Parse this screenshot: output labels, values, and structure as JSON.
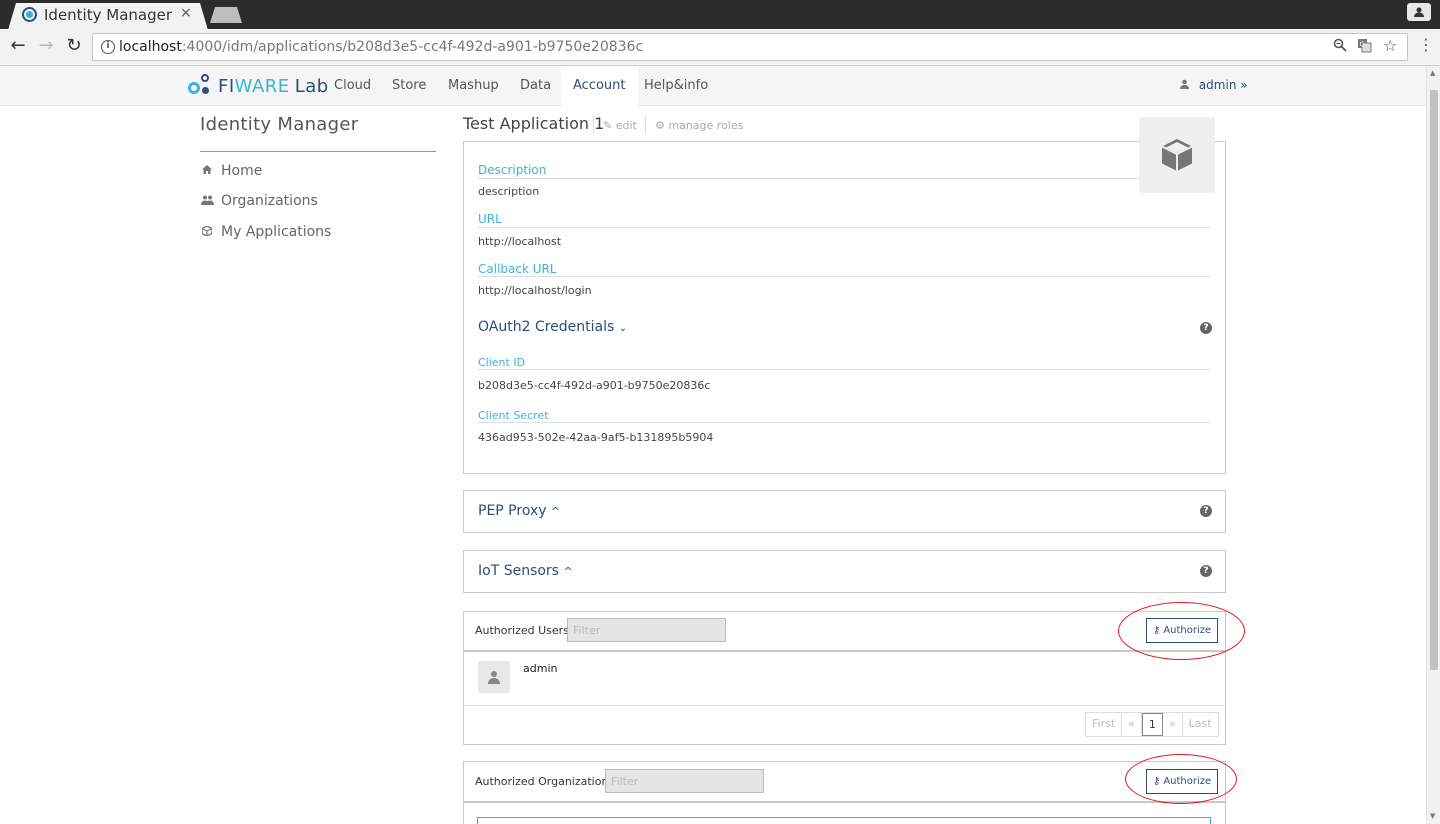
{
  "browser": {
    "tab_title": "Identity Manager",
    "tab_close": "×",
    "url_host": "localhost",
    "url_path": ":4000/idm/applications/b208d3e5-cc4f-492d-a901-b9750e20836c",
    "profile_icon": "person-icon"
  },
  "nav": {
    "logo_fi": "FI",
    "logo_ware": "WARE",
    "logo_lab": "Lab",
    "items": [
      "Cloud",
      "Store",
      "Mashup",
      "Data",
      "Account",
      "Help&info"
    ],
    "active": "Account",
    "user": "admin"
  },
  "sidebar": {
    "title": "Identity Manager",
    "items": [
      {
        "label": "Home",
        "icon": "home-icon"
      },
      {
        "label": "Organizations",
        "icon": "users-icon"
      },
      {
        "label": "My Applications",
        "icon": "cube-icon"
      }
    ]
  },
  "app": {
    "title": "Test Application 1",
    "edit": "edit",
    "manage_roles": "manage roles",
    "description_label": "Description",
    "description": "description",
    "url_label": "URL",
    "url": "http://localhost",
    "callback_label": "Callback URL",
    "callback": "http://localhost/login",
    "oauth_label": "OAuth2 Credentials",
    "client_id_label": "Client ID",
    "client_id": "b208d3e5-cc4f-492d-a901-b9750e20836c",
    "client_secret_label": "Client Secret",
    "client_secret": "436ad953-502e-42aa-9af5-b131895b5904"
  },
  "pep_proxy": {
    "label": "PEP Proxy"
  },
  "iot_sensors": {
    "label": "IoT Sensors"
  },
  "authorized_users": {
    "label": "Authorized Users",
    "filter_placeholder": "Filter",
    "authorize": "Authorize",
    "users": [
      "admin"
    ],
    "pager": [
      "First",
      "«",
      "1",
      "»",
      "Last"
    ]
  },
  "authorized_orgs": {
    "label": "Authorized Organizations",
    "filter_placeholder": "Filter",
    "authorize": "Authorize"
  },
  "colors": {
    "brand_dark": "#2d4e7a",
    "brand_light": "#3cb3d6",
    "highlight_ring": "#e0191f"
  }
}
